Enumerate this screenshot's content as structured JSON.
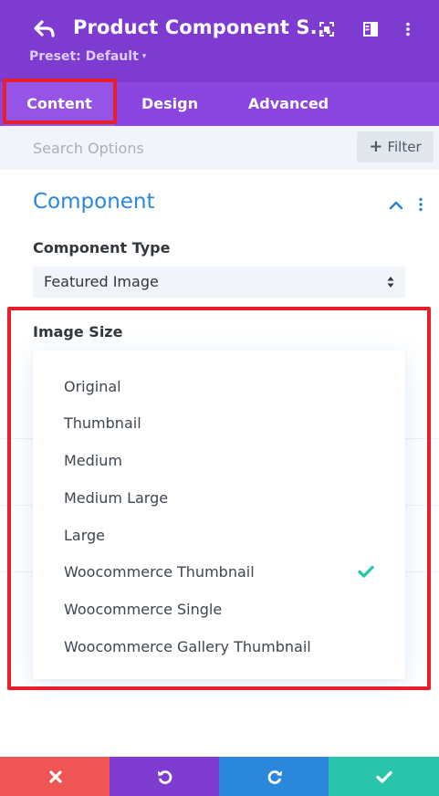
{
  "header": {
    "title": "Product Component S...",
    "preset_label": "Preset: Default",
    "caret": "▾"
  },
  "tabs": [
    {
      "label": "Content",
      "active": true
    },
    {
      "label": "Design",
      "active": false
    },
    {
      "label": "Advanced",
      "active": false
    }
  ],
  "search": {
    "placeholder": "Search Options",
    "filter_label": "Filter",
    "filter_plus": "+"
  },
  "section": {
    "title": "Component"
  },
  "component_type": {
    "label": "Component Type",
    "value": "Featured Image"
  },
  "image_size": {
    "label": "Image Size",
    "options": [
      "Original",
      "Thumbnail",
      "Medium",
      "Medium Large",
      "Large",
      "Woocommerce Thumbnail",
      "Woocommerce Single",
      "Woocommerce Gallery Thumbnail"
    ],
    "selected": "Woocommerce Thumbnail"
  },
  "footer": {
    "buttons": [
      {
        "icon": "close-icon",
        "color": "#ef5555"
      },
      {
        "icon": "undo-icon",
        "color": "#7e3bd0"
      },
      {
        "icon": "redo-icon",
        "color": "#2b87da"
      },
      {
        "icon": "check-icon",
        "color": "#29c4a9"
      }
    ]
  },
  "colors": {
    "header": "#7e3bd0",
    "tabs": "#8b46e0",
    "accent": "#2b87da",
    "check": "#29c4a9",
    "highlight": "#e81f2a"
  }
}
